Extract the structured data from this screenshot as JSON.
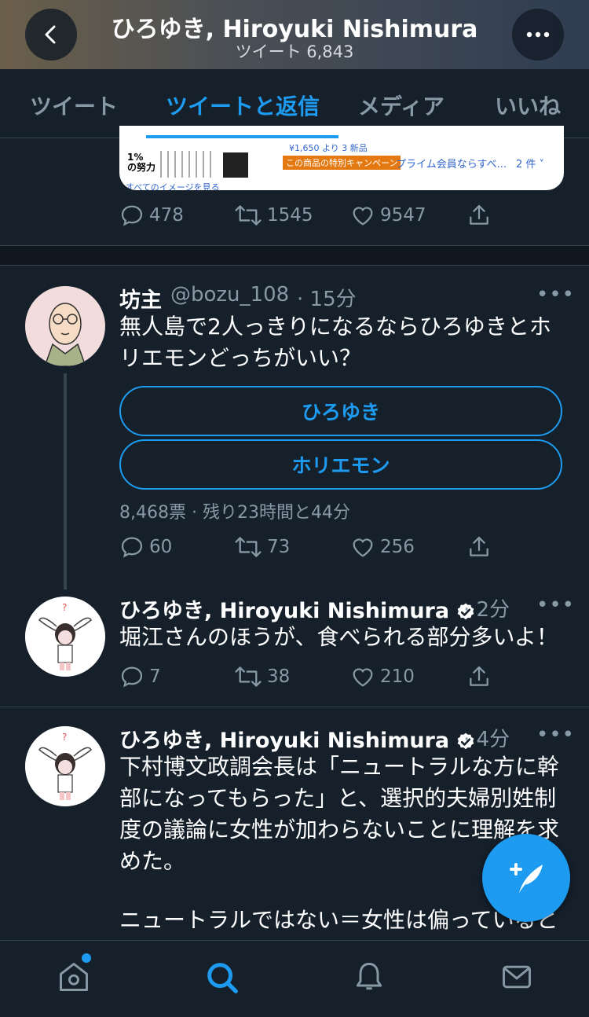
{
  "header": {
    "title": "ひろゆき, Hiroyuki Nishimura",
    "subtitle": "ツイート 6,843"
  },
  "tabs": [
    {
      "label": "ツイート",
      "active": false
    },
    {
      "label": "ツイートと返信",
      "active": true
    },
    {
      "label": "メディア",
      "active": false
    },
    {
      "label": "いいね",
      "active": false
    }
  ],
  "card": {
    "price": "¥1,650 より 3 新品",
    "badge": "1%\nの努力",
    "promo": "この商品の特別キャンペーン",
    "prime": "プライム会員ならすべ...",
    "count": "2 件 ˅",
    "more": "すべてのイメージを見る"
  },
  "tweet0_actions": {
    "replies": "478",
    "retweets": "1545",
    "likes": "9547"
  },
  "tweet1": {
    "name": "坊主",
    "handle": "@bozu_108",
    "time": "· 15分",
    "text": "無人島で2人っきりになるならひろゆきとホリエモンどっちがいい？",
    "poll_options": [
      "ひろゆき",
      "ホリエモン"
    ],
    "poll_meta": "8,468票 · 残り23時間と44分",
    "actions": {
      "replies": "60",
      "retweets": "73",
      "likes": "256"
    }
  },
  "tweet2": {
    "name": "ひろゆき, Hiroyuki Nishimura",
    "time": "· 2分",
    "text": "堀江さんのほうが、食べられる部分多いよ！",
    "actions": {
      "replies": "7",
      "retweets": "38",
      "likes": "210"
    }
  },
  "tweet3": {
    "name": "ひろゆき, Hiroyuki Nishimura",
    "time": "· 4分",
    "text": "下村博文政調会長は「ニュートラルな方に幹部になってもらった」と、選択的夫婦別姓制度の議論に女性が加わらないことに理解を求めた。",
    "text2": "ニュートラルではない＝女性は偏っていると"
  },
  "more_label": "•••",
  "colors": {
    "accent": "#1d9bf0",
    "background": "#15202b",
    "muted": "#8899a6"
  }
}
